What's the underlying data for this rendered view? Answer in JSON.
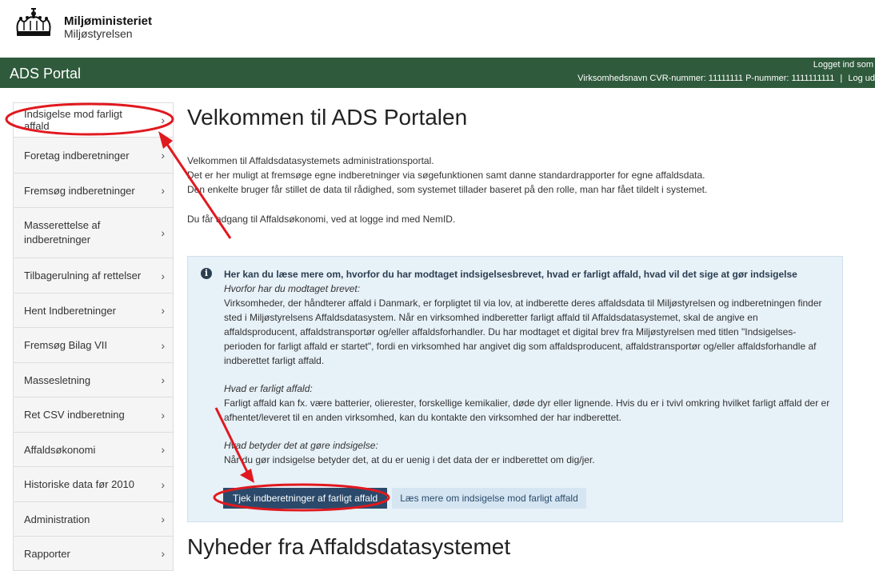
{
  "header": {
    "org_name": "Miljøministeriet",
    "org_sub": "Miljøstyrelsen",
    "logo_icon": "crown-icon"
  },
  "portal": {
    "title": "ADS Portal",
    "logged_in": "Logget ind som",
    "company_label": "Virksomhedsnavn",
    "cvr": "CVR-nummer: 11111111",
    "pnumber": "P-nummer: 1111111111",
    "separator": "|",
    "logout": "Log ud"
  },
  "sidebar": {
    "items": [
      {
        "label": "Indsigelse mod farligt affald"
      },
      {
        "label": "Foretag indberetninger"
      },
      {
        "label": "Fremsøg indberetninger"
      },
      {
        "label": "Masserettelse af indberetninger"
      },
      {
        "label": "Tilbagerulning af rettelser"
      },
      {
        "label": "Hent Indberetninger"
      },
      {
        "label": "Fremsøg Bilag VII"
      },
      {
        "label": "Massesletning"
      },
      {
        "label": "Ret CSV indberetning"
      },
      {
        "label": "Affaldsøkonomi"
      },
      {
        "label": "Historiske data før 2010"
      },
      {
        "label": "Administration"
      },
      {
        "label": "Rapporter"
      }
    ],
    "chevron": "›"
  },
  "main": {
    "title": "Velkommen til ADS Portalen",
    "intro": [
      "Velkommen til Affaldsdatasystemets administrationsportal.",
      "Det er her muligt at fremsøge egne indberetninger via søgefunktionen samt danne standardrapporter for egne affaldsdata.",
      "Den enkelte bruger får stillet de data til rådighed, som systemet tillader baseret på den rolle, man har fået tildelt i systemet."
    ],
    "nemid": "Du får adgang til Affaldsøkonomi, ved at logge ind med NemID."
  },
  "infobox": {
    "icon": "info-icon",
    "icon_glyph": "i",
    "heading": "Her kan du læse mere om, hvorfor du har modtaget indsigelsesbrevet, hvad er farligt affald, hvad vil det sige at gør indsigelse",
    "q1": "Hvorfor har du modtaget brevet:",
    "p1": "Virksomheder, der håndterer affald i Danmark, er forpligtet til via lov, at indberette deres affaldsdata til Miljøstyrelsen og indberetningen finder sted i Miljøstyrelsens Affaldsdatasystem. Når en virksomhed indberetter farligt affald til Affaldsdatasystemet, skal de angive en affaldsproducent, affaldstransportør og/eller affaldsforhandler. Du har modtaget et digital brev fra Miljøstyrelsen med titlen \"Indsigelses-perioden for farligt affald er startet\", fordi en virksomhed har angivet dig som affaldsproducent, affaldstransportør og/eller affaldsforhandle af indberettet farligt affald.",
    "q2": "Hvad er farligt affald:",
    "p2": "Farligt affald kan fx. være batterier, olierester, forskellige kemikalier, døde dyr eller lignende. Hvis du er i tvivl omkring hvilket farligt affald der er afhentet/leveret til en anden virksomhed, kan du kontakte den virksomhed der har indberettet.",
    "q3": "Hvad betyder det at gøre indsigelse:",
    "p3": "Når du gør indsigelse betyder det, at du er uenig i det data der er indberettet om dig/jer.",
    "btn_primary": "Tjek indberetninger af farligt affald",
    "btn_secondary": "Læs mere om indsigelse mod farligt affald"
  },
  "news": {
    "title": "Nyheder fra Affaldsdatasystemet"
  },
  "colors": {
    "portal_bar": "#2f5a3c",
    "info_bg": "#e7f1f8",
    "primary_btn": "#2b4a6b",
    "annotation": "#e0191f"
  }
}
